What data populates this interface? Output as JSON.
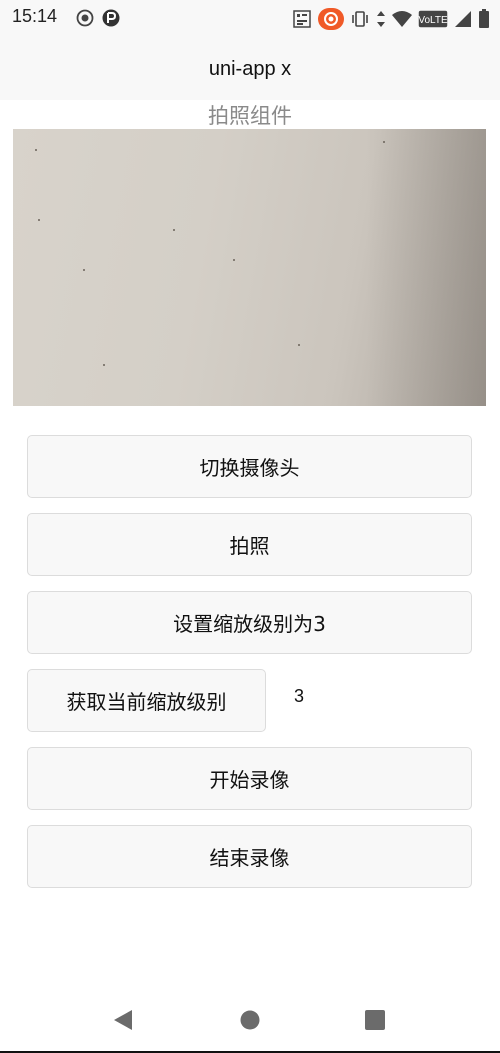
{
  "status_bar": {
    "time": "15:14",
    "network_label": "VoLTE"
  },
  "nav": {
    "title": "uni-app x"
  },
  "page": {
    "section_title": "拍照组件"
  },
  "buttons": {
    "switch_camera": "切换摄像头",
    "take_photo": "拍照",
    "set_zoom": "设置缩放级别为3",
    "get_zoom": "获取当前缩放级别",
    "start_record": "开始录像",
    "stop_record": "结束录像"
  },
  "zoom": {
    "current_value": "3"
  },
  "icons": {
    "status_left": [
      "record-icon",
      "app-icon"
    ],
    "status_right": [
      "sim-card-icon",
      "camera-active-icon",
      "vibrate-icon",
      "data-arrows-icon",
      "wifi-icon",
      "volte-icon",
      "signal-icon",
      "battery-icon"
    ],
    "nav_buttons": [
      "back-icon",
      "home-icon",
      "recents-icon"
    ]
  },
  "colors": {
    "nav_background": "#f8f8f8",
    "button_background": "#f8f8f8",
    "section_title": "#8a8a8a",
    "camera_active": "#f05a28"
  }
}
